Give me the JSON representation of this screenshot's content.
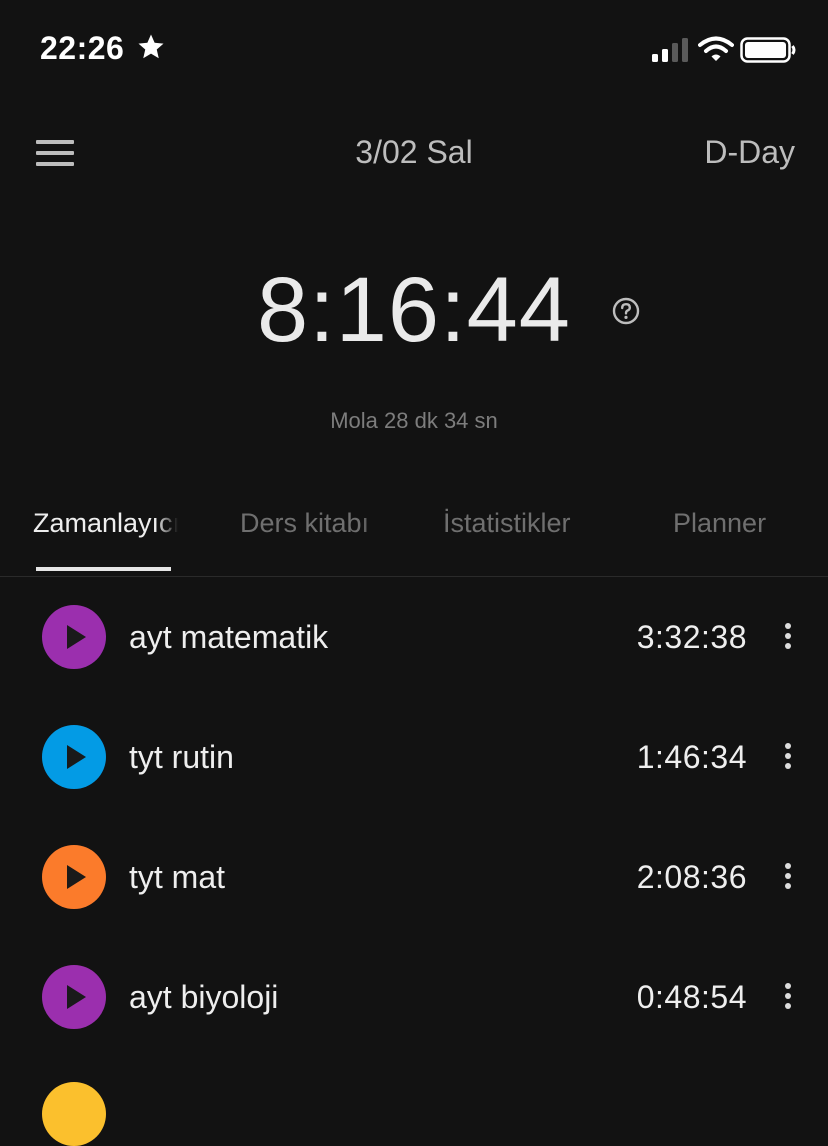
{
  "status_bar": {
    "time": "22:26",
    "icons": [
      "star-icon",
      "cellular-signal-icon",
      "wifi-icon",
      "battery-icon"
    ]
  },
  "header": {
    "menu_icon": "hamburger-menu-icon",
    "date": "3/02 Sal",
    "dday": "D-Day"
  },
  "timer": {
    "value": "8:16:44",
    "help_icon": "question-circle-icon",
    "break_text": "Mola 28 dk 34 sn"
  },
  "tabs": [
    {
      "label": "Zamanlayıcı",
      "active": true
    },
    {
      "label": "Ders kitabı",
      "active": false
    },
    {
      "label": "İstatistikler",
      "active": false
    },
    {
      "label": "Planner",
      "active": false
    }
  ],
  "subjects": [
    {
      "name": "ayt matematik",
      "time": "3:32:38",
      "color": "#9b2fae"
    },
    {
      "name": "tyt rutin",
      "time": "1:46:34",
      "color": "#039be5"
    },
    {
      "name": "tyt mat",
      "time": "2:08:36",
      "color": "#fb7b2b"
    },
    {
      "name": "ayt biyoloji",
      "time": "0:48:54",
      "color": "#9b2fae"
    }
  ],
  "partial_next_color": "#fbc02d",
  "colors": {
    "background": "#121212",
    "text_primary": "#eeeeee",
    "text_muted": "#7d7d7d"
  }
}
